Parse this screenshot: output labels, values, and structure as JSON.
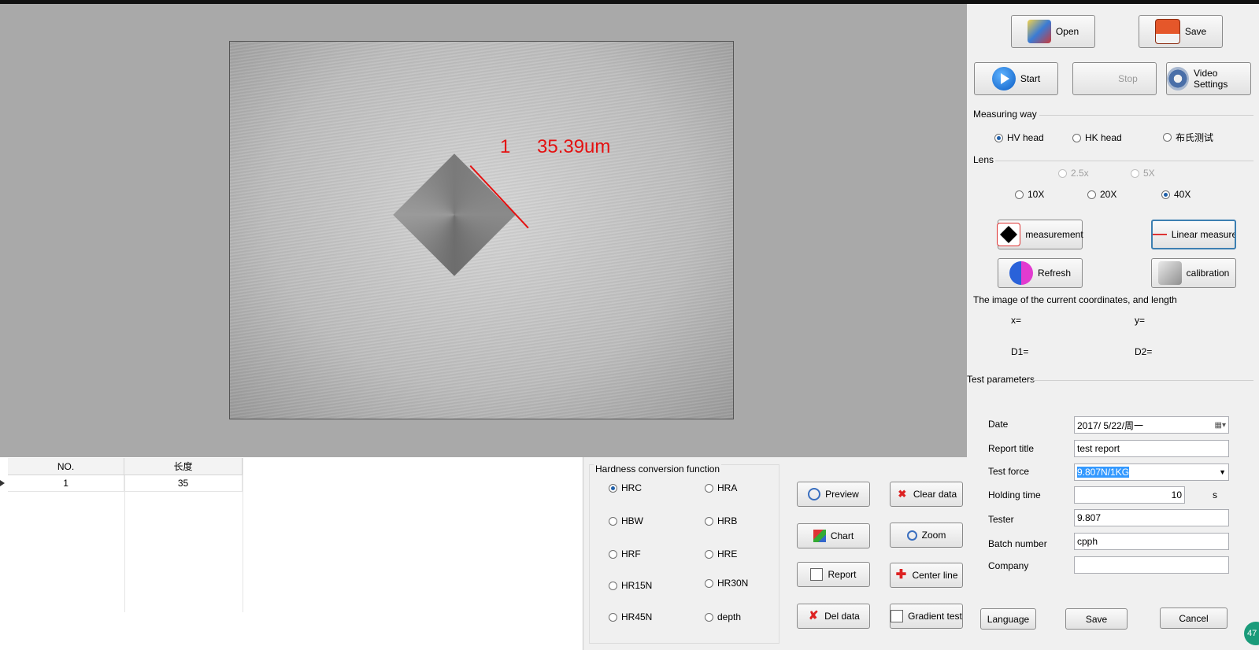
{
  "overlay": {
    "index": "1",
    "length": "35.39um"
  },
  "toolbar": {
    "open": "Open",
    "save": "Save",
    "start": "Start",
    "stop": "Stop",
    "video_settings": "Video Settings"
  },
  "measuring_way": {
    "label": "Measuring way",
    "options": [
      "HV head",
      "HK head",
      "布氏测试"
    ],
    "selected": "HV head"
  },
  "lens": {
    "label": "Lens",
    "options": [
      "2.5x",
      "5X",
      "10X",
      "20X",
      "40X"
    ],
    "selected": "40X"
  },
  "tools": {
    "measurement": "measurement",
    "linear": "Linear measurem",
    "refresh": "Refresh",
    "calibration": "calibration"
  },
  "coords": {
    "label": "The image of the current coordinates, and length",
    "x": "x=",
    "y": "y=",
    "d1": "D1=",
    "d2": "D2="
  },
  "params": {
    "label": "Test parameters",
    "date_label": "Date",
    "date_value": "2017/  5/22/周一",
    "report_title_label": "Report title",
    "report_title_value": "test report",
    "test_force_label": "Test force",
    "test_force_value": "9.807N/1KG",
    "holding_time_label": "Holding time",
    "holding_time_value": "10",
    "holding_time_unit": "s",
    "tester_label": "Tester",
    "tester_value": "9.807",
    "batch_label": "Batch number",
    "batch_value": "cpph",
    "company_label": "Company",
    "company_value": ""
  },
  "bottom_buttons": {
    "language": "Language",
    "save": "Save",
    "cancel": "Cancel"
  },
  "table": {
    "headers": [
      "NO.",
      "长度"
    ],
    "rows": [
      [
        "1",
        "35"
      ]
    ]
  },
  "hardness": {
    "label": "Hardness conversion function",
    "options": [
      "HRC",
      "HRA",
      "HBW",
      "HRB",
      "HRF",
      "HRE",
      "HR15N",
      "HR30N",
      "HR45N",
      "depth"
    ],
    "selected": "HRC"
  },
  "actions": {
    "preview": "Preview",
    "clear_data": "Clear data",
    "chart": "Chart",
    "zoom": "Zoom",
    "report": "Report",
    "center_line": "Center line",
    "del_data": "Del data",
    "gradient_test": "Gradient test"
  },
  "badge": "47",
  "colors": {
    "overlay": "#e41010",
    "selection": "#3399ff",
    "view_bg": "#a9a9a9"
  }
}
